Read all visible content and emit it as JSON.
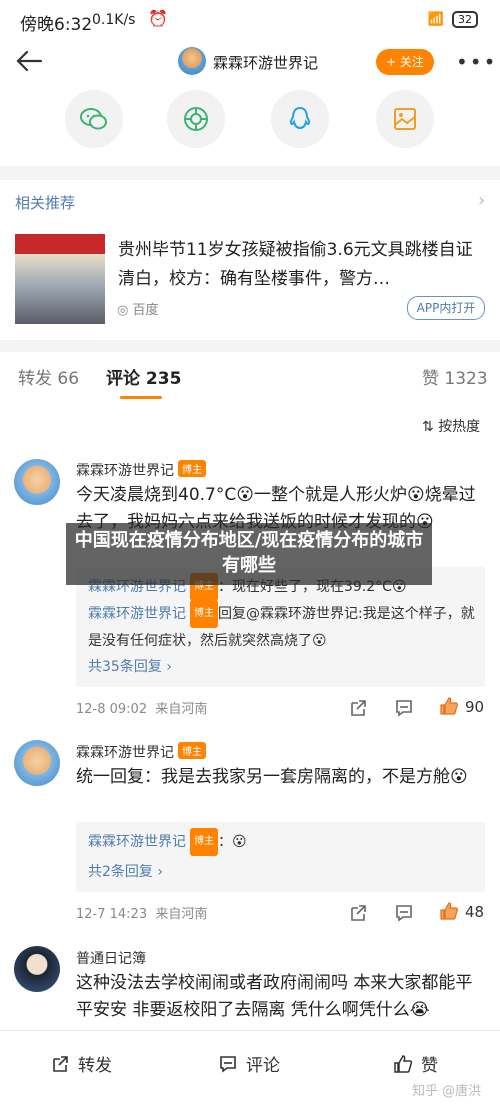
{
  "status_bar": {
    "time": "傍晚6:32",
    "speed": "0.1K/s",
    "battery": "32"
  },
  "nav": {
    "title": "霖霖环游世界记",
    "follow_label": "+ 关注",
    "more": "•••"
  },
  "share_icons": [
    "wechat-icon",
    "moments-icon",
    "qq-icon",
    "save-image-icon"
  ],
  "related": {
    "title": "相关推荐",
    "headline": "贵州毕节11岁女孩疑被指偷3.6元文具跳楼自证清白，校方：确有坠楼事件，警方…",
    "source": "百度",
    "app_button": "APP内打开"
  },
  "tabs": {
    "repost": "转发 66",
    "comment": "评论 235",
    "like": "赞 1323"
  },
  "sort_label": "按热度",
  "badge_label": "博主",
  "comments": [
    {
      "username": "霖霖环游世界记",
      "text": "今天凌晨烧到40.7°C😮一整个就是人形火炉😮烧晕过去了，我妈妈六点来给我送饭的时候才发现的😮",
      "replies": [
        {
          "name": "霖霖环游世界记",
          "text": "：现在好些了，现在39.2°C😮"
        },
        {
          "name": "霖霖环游世界记",
          "text": "回复@霖霖环游世界记:我是这个样子，就是没有任何症状，然后就突然高烧了😮"
        }
      ],
      "more_replies": "共35条回复 ›",
      "time": "12-8 09:02",
      "location": "来自河南",
      "likes": "90"
    },
    {
      "username": "霖霖环游世界记",
      "text": "统一回复：我是去我家另一套房隔离的，不是方舱😮",
      "replies": [
        {
          "name": "霖霖环游世界记",
          "text": "：😮"
        }
      ],
      "more_replies": "共2条回复 ›",
      "time": "12-7 14:23",
      "location": "来自河南",
      "likes": "48"
    },
    {
      "username": "普通日记簿",
      "text": "这种没法去学校闹闹或者政府闹闹吗 本来大家都能平平安安 非要返校阳了去隔离 凭什么啊凭什么😭"
    }
  ],
  "bottom_bar": {
    "repost": "转发",
    "comment": "评论",
    "like": "赞"
  },
  "watermark": "知乎 @唐洪",
  "overlay_caption": "中国现在疫情分布地区/现在疫情分布的城市有哪些",
  "colors": {
    "accent": "#ff8200",
    "link": "#507daf"
  }
}
